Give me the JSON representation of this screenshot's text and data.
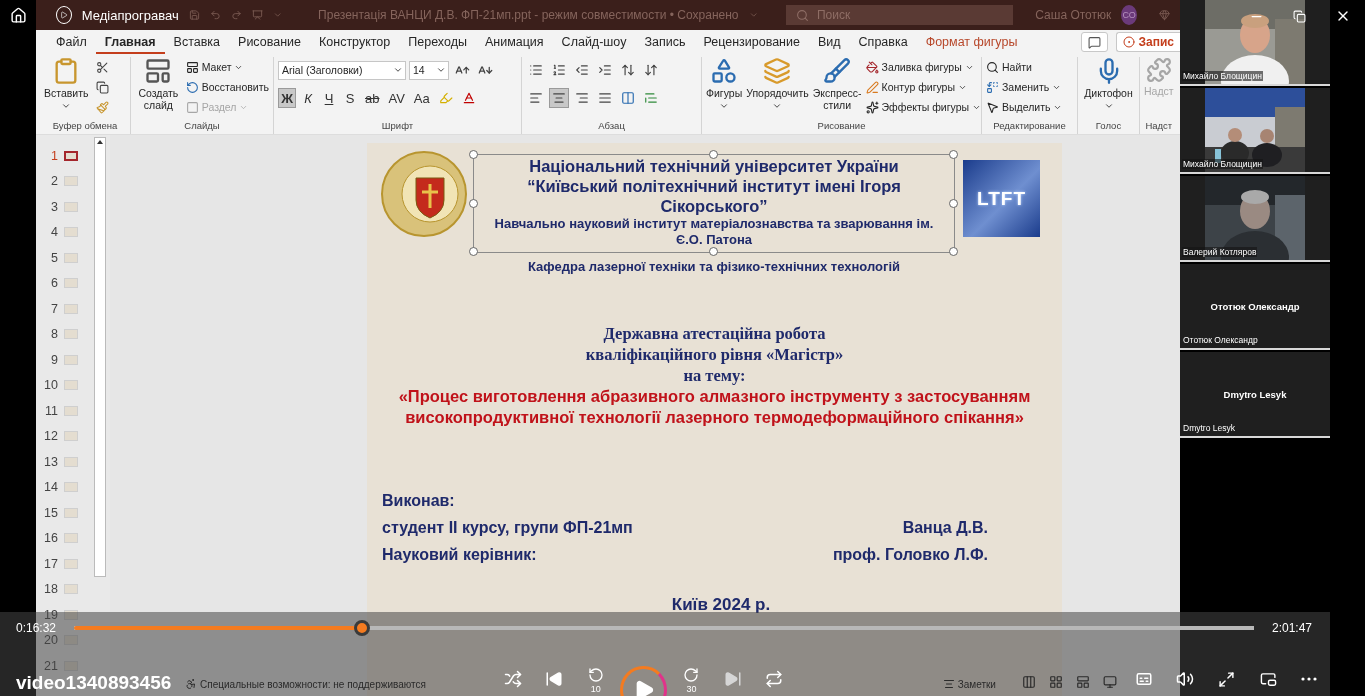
{
  "player": {
    "title": "Медіапрогравач",
    "file_name": "video1340893456",
    "elapsed": "0:16:32",
    "duration": "2:01:47",
    "progress": {
      "level": 0.244
    },
    "skip_back": "10",
    "skip_forward": "30",
    "playing": false
  },
  "app": {
    "document_title": "Презентація ВАНЦИ Д.В. ФП-21мп.ppt  -  режим совместимости • Сохранено",
    "search_placeholder": "Поиск",
    "user_name": "Саша Ототюк",
    "user_initials": "СО",
    "record_button": "Запис"
  },
  "ribbon_tabs": [
    {
      "label": "Файл",
      "selected": false,
      "kind": "normal"
    },
    {
      "label": "Главная",
      "selected": true,
      "kind": "normal"
    },
    {
      "label": "Вставка",
      "selected": false,
      "kind": "normal"
    },
    {
      "label": "Рисование",
      "selected": false,
      "kind": "normal"
    },
    {
      "label": "Конструктор",
      "selected": false,
      "kind": "normal"
    },
    {
      "label": "Переходы",
      "selected": false,
      "kind": "normal"
    },
    {
      "label": "Анимация",
      "selected": false,
      "kind": "normal"
    },
    {
      "label": "Слайд-шоу",
      "selected": false,
      "kind": "normal"
    },
    {
      "label": "Запись",
      "selected": false,
      "kind": "normal"
    },
    {
      "label": "Рецензирование",
      "selected": false,
      "kind": "normal"
    },
    {
      "label": "Вид",
      "selected": false,
      "kind": "normal"
    },
    {
      "label": "Справка",
      "selected": false,
      "kind": "normal"
    },
    {
      "label": "Формат фигуры",
      "selected": false,
      "kind": "contextual"
    }
  ],
  "ribbon": {
    "clipboard": {
      "name": "Буфер обмена",
      "paste": "Вставить"
    },
    "slides": {
      "name": "Слайды",
      "new_slide": "Создать слайд",
      "layout": "Макет",
      "reset": "Восстановить",
      "section": {
        "label": "Раздел",
        "disabled": true
      }
    },
    "font": {
      "name": "Шрифт",
      "font_family": "Arial (Заголовки)",
      "font_size": "14",
      "styles": [
        {
          "label": "Ж",
          "selected": true
        },
        {
          "label": "К",
          "selected": false
        },
        {
          "label": "Ч",
          "selected": false
        },
        {
          "label": "S",
          "selected": false
        },
        {
          "label": "ab",
          "selected": false
        },
        {
          "label": "AV",
          "selected": false
        },
        {
          "label": "Aa",
          "selected": false
        }
      ]
    },
    "paragraph": {
      "name": "Абзац",
      "alignment": [
        {
          "kind": "left",
          "selected": false
        },
        {
          "kind": "center",
          "selected": true
        },
        {
          "kind": "right",
          "selected": false
        },
        {
          "kind": "justify",
          "selected": false
        }
      ]
    },
    "drawing": {
      "name": "Рисование",
      "shapes": "Фигуры",
      "arrange": "Упорядочить",
      "quick_styles": "Экспресс-стили",
      "fill": "Заливка фигуры",
      "outline": "Контур фигуры",
      "effects": "Эффекты фигуры"
    },
    "editing": {
      "name": "Редактирование",
      "find": "Найти",
      "replace": "Заменить",
      "select": "Выделить"
    },
    "voice": {
      "name": "Голос",
      "dictate": "Диктофон"
    },
    "addins": {
      "name": "Надст",
      "label": "Надст",
      "disabled": true
    }
  },
  "slides": [
    {
      "number": "1",
      "selected": true
    },
    {
      "number": "2",
      "selected": false
    },
    {
      "number": "3",
      "selected": false
    },
    {
      "number": "4",
      "selected": false
    },
    {
      "number": "5",
      "selected": false
    },
    {
      "number": "6",
      "selected": false
    },
    {
      "number": "7",
      "selected": false
    },
    {
      "number": "8",
      "selected": false
    },
    {
      "number": "9",
      "selected": false
    },
    {
      "number": "10",
      "selected": false
    },
    {
      "number": "11",
      "selected": false
    },
    {
      "number": "12",
      "selected": false
    },
    {
      "number": "13",
      "selected": false
    },
    {
      "number": "14",
      "selected": false
    },
    {
      "number": "15",
      "selected": false
    },
    {
      "number": "16",
      "selected": false
    },
    {
      "number": "17",
      "selected": false
    },
    {
      "number": "18",
      "selected": false
    },
    {
      "number": "19",
      "selected": false
    },
    {
      "number": "20",
      "selected": false
    },
    {
      "number": "21",
      "selected": false
    }
  ],
  "slide": {
    "header_lines": [
      "Національний технічний університет України",
      "“Київський політехнічний інститут імені Ігоря",
      "Сікорського”"
    ],
    "institute_lines": [
      "Навчально науковий інститут матеріалознавства та зварювання ім.",
      "Є.О. Патона"
    ],
    "department": "Кафедра лазерної техніки та фізико-технічних технологій",
    "logo_text": "LTFT",
    "thesis_lines": [
      "Державна атестаційна робота",
      "кваліфікаційного рівня «Магістр»",
      "на тему:"
    ],
    "topic_lines": [
      "«Процес виготовлення абразивного алмазного інструменту  з застосуванням",
      "високопродуктивної технології лазерного термодеформаційного спікання»"
    ],
    "author_heading": "Виконав:",
    "signatures": [
      {
        "role": "студент ІІ курсу, групи ФП-21мп",
        "name": "Ванца Д.В."
      },
      {
        "role": "Науковий керівник:",
        "name": "проф. Головко Л.Ф."
      }
    ],
    "city_year": "Київ 2024 р."
  },
  "status_bar": {
    "accessibility": "Специальные возможности: не поддерживаются",
    "notes": "Заметки"
  },
  "participants": [
    {
      "name": "Михайло Блощицин",
      "kind": "video"
    },
    {
      "name": "Михайло Блощицин",
      "kind": "video"
    },
    {
      "name": "Валерий Котляров",
      "kind": "video"
    },
    {
      "name": "Ототюк Олександр",
      "kind": "audio",
      "center_name": "Ототюк Олександр"
    },
    {
      "name": "Dmytro Lesyk",
      "kind": "audio",
      "center_name": "Dmytro Lesyk"
    }
  ]
}
